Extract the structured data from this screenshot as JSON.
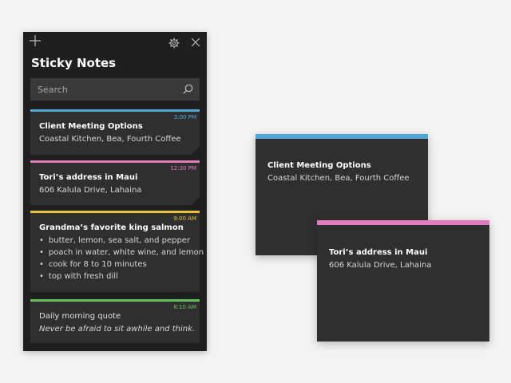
{
  "app": {
    "title": "Sticky Notes"
  },
  "search": {
    "placeholder": "Search"
  },
  "colors": {
    "blue": "#53a7d4",
    "pink": "#e27abe",
    "yellow": "#e9c33b",
    "green": "#65c15e",
    "panel": "#1f1f1f",
    "note": "#2f2f2f"
  },
  "icons": {
    "add": "add-icon",
    "settings": "gear-icon",
    "close": "close-icon",
    "search": "search-icon"
  },
  "notes": [
    {
      "time": "3:00 PM",
      "title": "Client Meeting Options",
      "body": "Coastal Kitchen, Bea, Fourth Coffee",
      "color": "#53a7d4"
    },
    {
      "time": "12:30 PM",
      "title": "Tori’s address in Maui",
      "body": "606 Kalula Drive, Lahaina",
      "color": "#e27abe"
    },
    {
      "time": "9:00 AM",
      "title": "Grandma’s favorite king salmon",
      "items": [
        "butter, lemon, sea salt, and pepper",
        "poach in water, white wine, and lemon",
        "cook for 8 to 10 minutes",
        "top with fresh dill"
      ],
      "color": "#e9c33b"
    },
    {
      "time": "8:10 AM",
      "title": "Daily morning quote",
      "body": "Never be afraid to sit awhile and think.",
      "color": "#65c15e"
    }
  ],
  "open_notes": [
    {
      "title": "Client Meeting Options",
      "body": "Coastal Kitchen, Bea, Fourth Coffee",
      "color": "#53a7d4"
    },
    {
      "title": "Tori’s address in Maui",
      "body": "606 Kalula Drive, Lahaina",
      "color": "#e27abe"
    }
  ]
}
